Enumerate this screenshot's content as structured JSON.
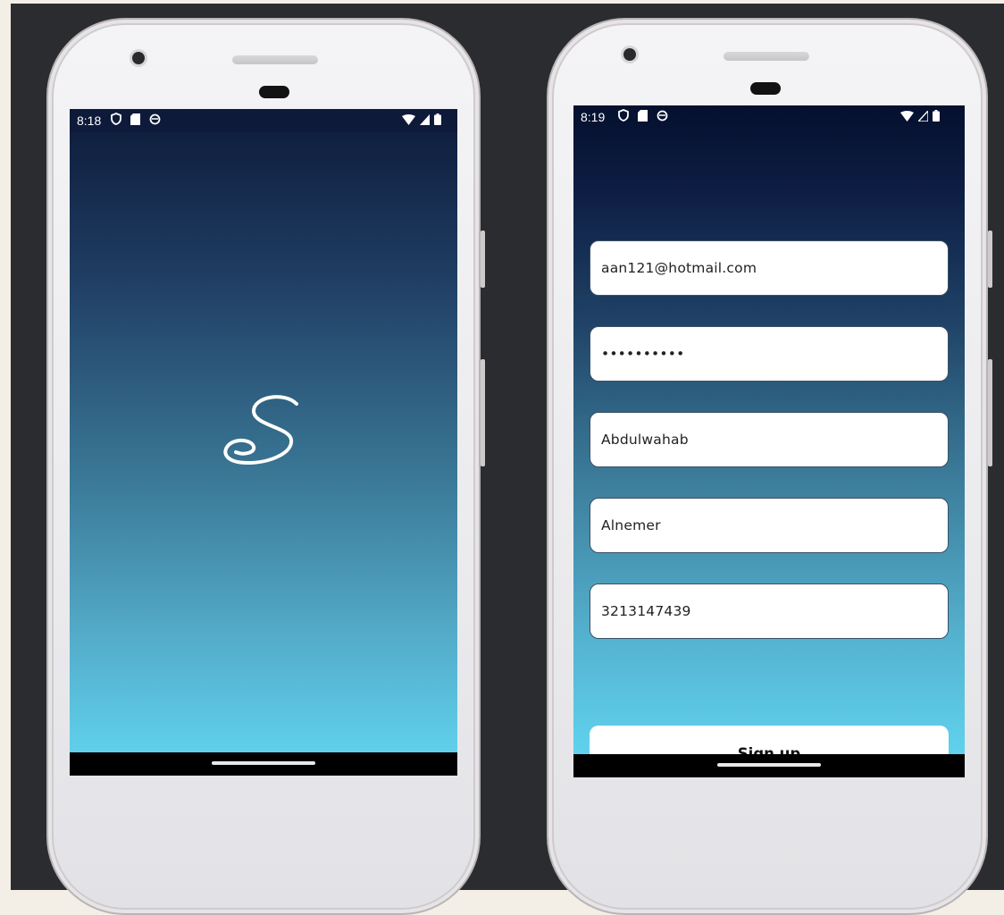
{
  "splash_screen": {
    "status_time": "8:18",
    "logo_letter": "S",
    "gradient_colors": [
      "#0d1a3a",
      "#62d7f2"
    ]
  },
  "signup_screen": {
    "status_time": "8:19",
    "fields": {
      "email": "aan121@hotmail.com",
      "password": "••••••••••",
      "first_name": "Abdulwahab",
      "last_name": "Alnemer",
      "phone": "3213147439"
    },
    "signup_label": "Sign up",
    "gradient_colors": [
      "#04102e",
      "#62d8f3"
    ]
  },
  "status_icons": [
    "shield-icon",
    "sd-card-icon",
    "sync-icon",
    "wifi-icon",
    "signal-icon",
    "battery-icon"
  ]
}
